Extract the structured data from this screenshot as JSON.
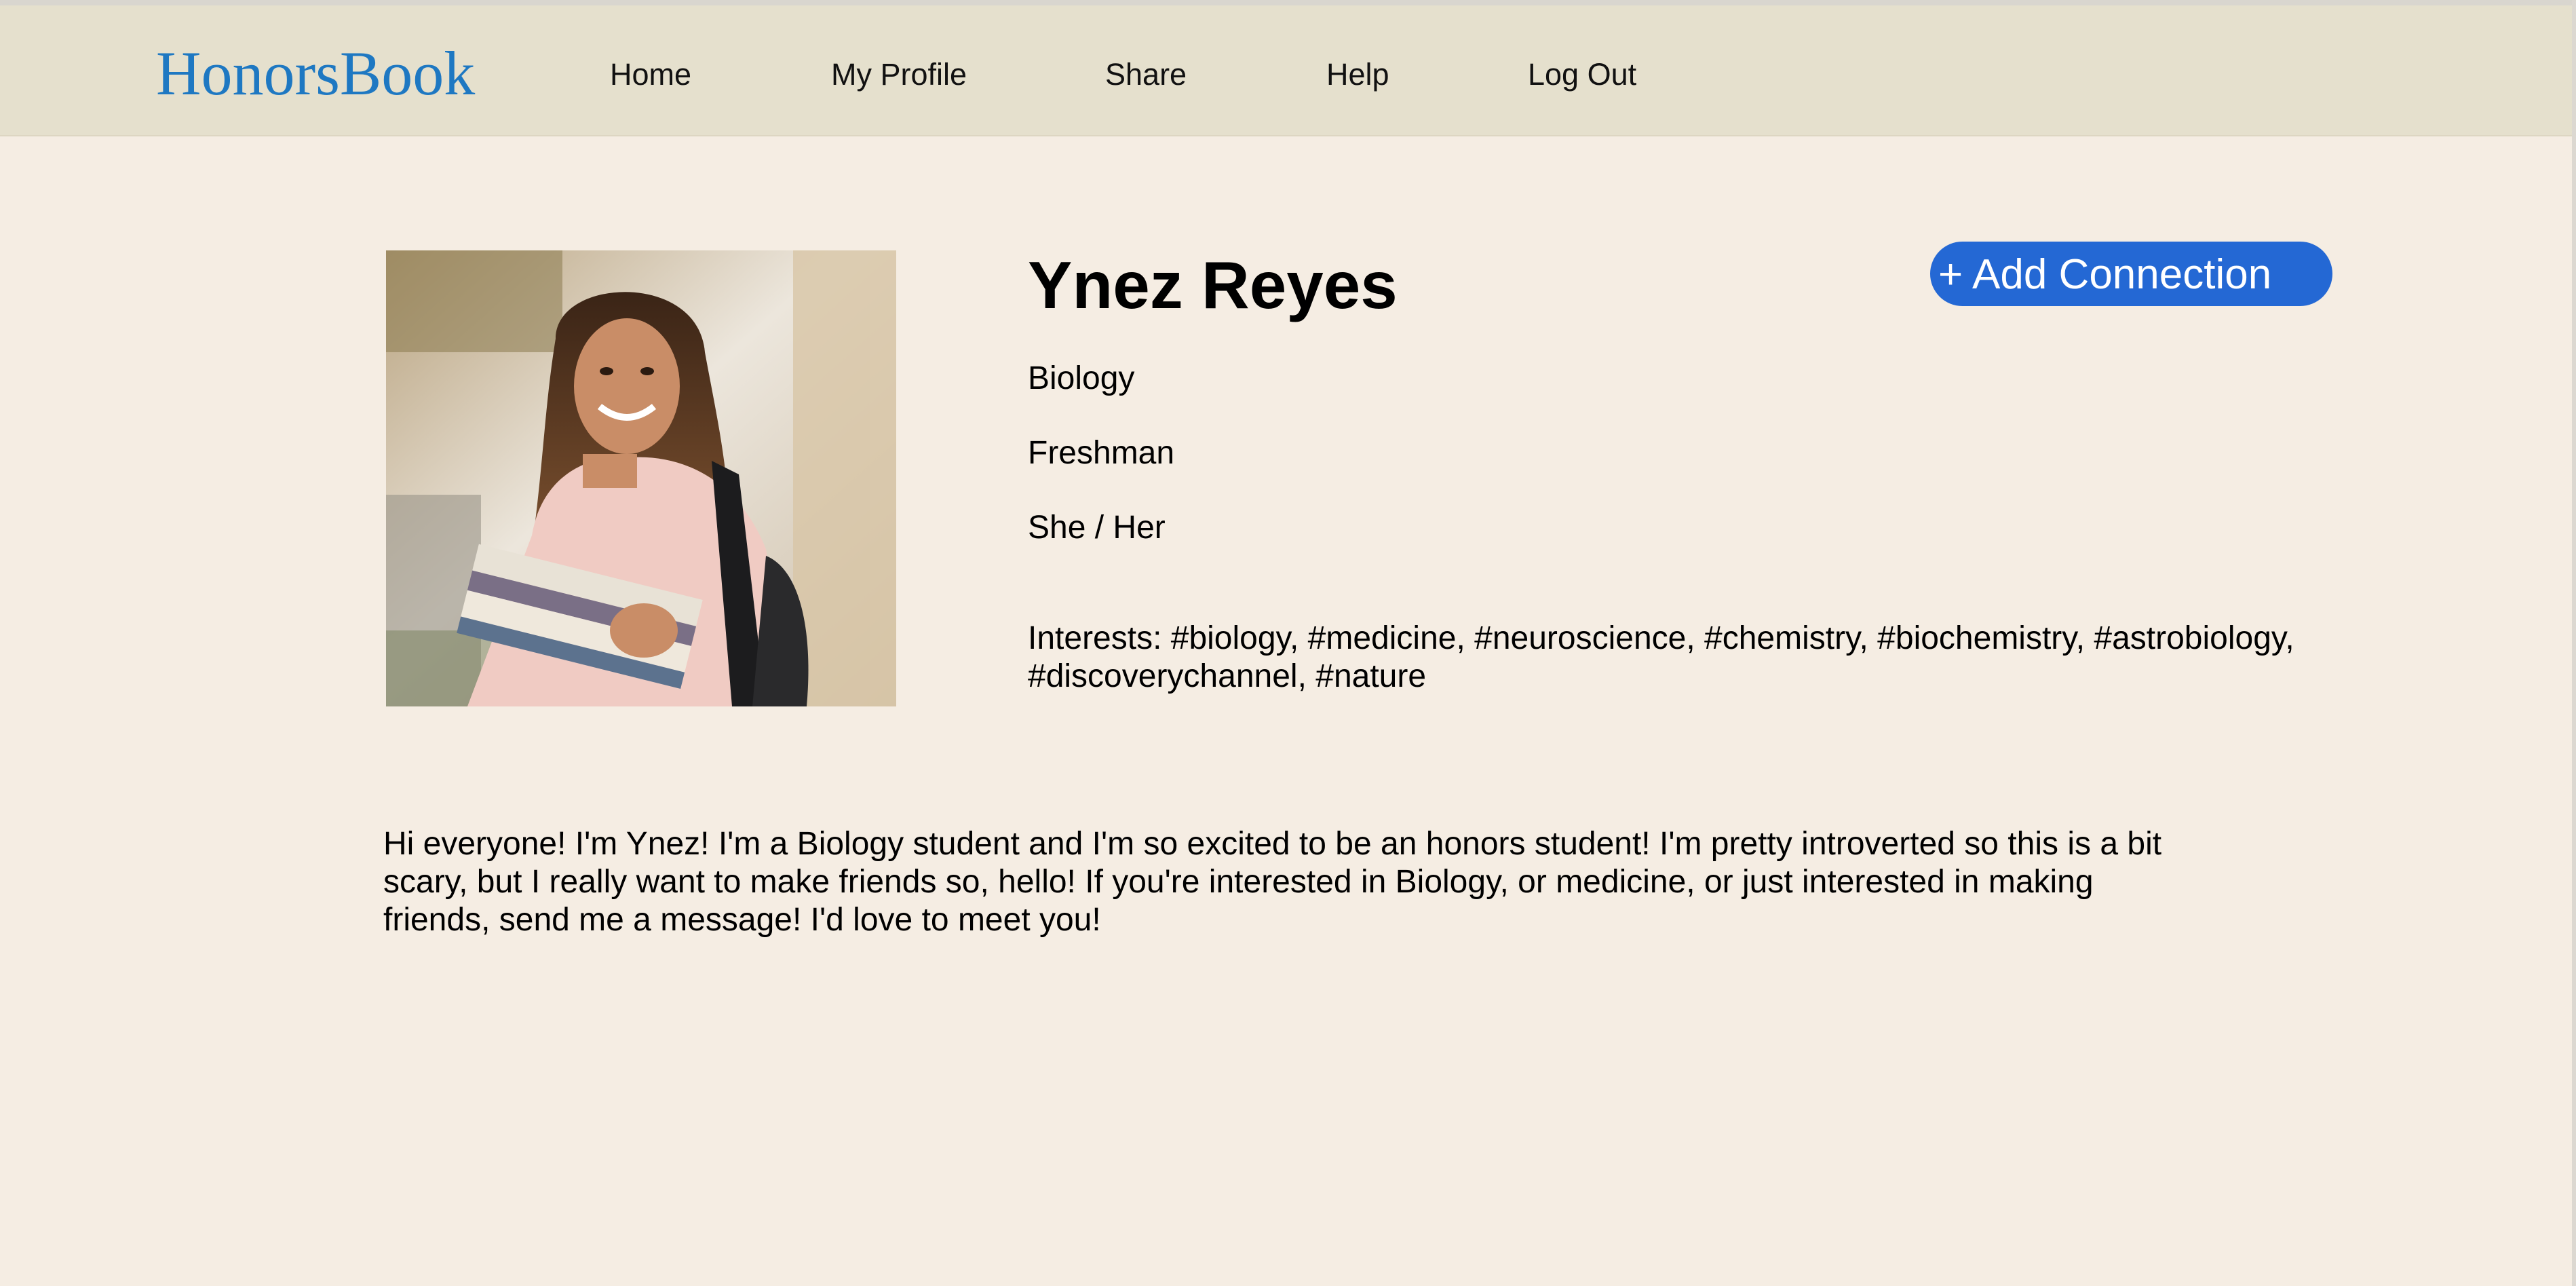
{
  "header": {
    "brand": "HonorsBook",
    "nav": {
      "home": "Home",
      "my_profile": "My Profile",
      "share": "Share",
      "help": "Help",
      "log_out": "Log Out"
    }
  },
  "profile": {
    "name": "Ynez Reyes",
    "major": "Biology",
    "year": "Freshman",
    "pronouns": "She / Her",
    "interests": "Interests: #biology, #medicine, #neuroscience, #chemistry, #biochemistry, #astrobiology, #discoverychannel, #nature",
    "bio": "Hi everyone! I'm Ynez! I'm a Biology student and I'm so excited to be an honors student! I'm pretty introverted so this is a bit scary, but I really want to make friends so, hello! If you're interested in Biology, or medicine, or just interested in making friends, send me a message! I'd love to meet you!",
    "add_connection_label": "+ Add Connection"
  },
  "colors": {
    "page_background": "#f5ede3",
    "navbar_background": "#e5e0cd",
    "brand": "#1e78c2",
    "button": "#2468d4"
  }
}
